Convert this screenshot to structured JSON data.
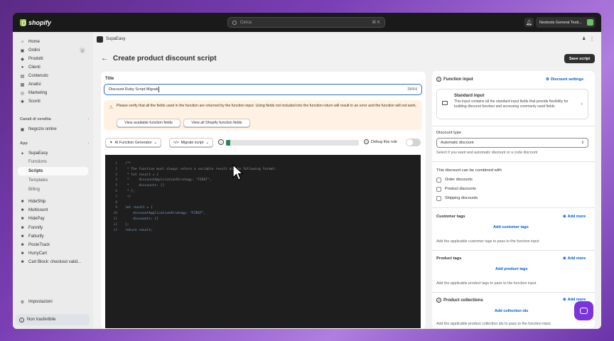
{
  "topbar": {
    "logo_text": "shopify",
    "search_placeholder": "Cerca",
    "search_shortcut": "⌘ K",
    "store_name": "Nextools General Testi..."
  },
  "sidebar": {
    "items": [
      {
        "label": "Home",
        "icon": "home-icon"
      },
      {
        "label": "Ordini",
        "icon": "orders-icon",
        "badge": "2"
      },
      {
        "label": "Prodotti",
        "icon": "tag-icon"
      },
      {
        "label": "Clienti",
        "icon": "person-icon"
      },
      {
        "label": "Contenuto",
        "icon": "content-icon"
      },
      {
        "label": "Analisi",
        "icon": "chart-icon"
      },
      {
        "label": "Marketing",
        "icon": "target-icon"
      },
      {
        "label": "Sconti",
        "icon": "discount-icon"
      }
    ],
    "sales_channels_label": "Canali di vendita",
    "online_store": "Negozio online",
    "apps_label": "App",
    "app_supaeasy": "SupaEasy",
    "subitems": [
      "Functions",
      "Scripts",
      "Templates",
      "Billing"
    ],
    "apps": [
      "HideShip",
      "Multicount",
      "HidePay",
      "Formify",
      "Fatturify",
      "PosteTrack",
      "HurryCart",
      "Cart Block: checkout valid..."
    ],
    "settings": "Impostazioni",
    "transfer": "Non trasferibile"
  },
  "app": {
    "name": "SupaEasy",
    "page_title": "Create product discount script",
    "save_label": "Save script"
  },
  "form": {
    "title_label": "Title",
    "title_value": "Discount Ruby Script Migrati",
    "title_count": "28/64",
    "banner_text": "Please verify that all the fields used in the function are returned by the function input. Using fields not included into the function return will result in an error and the function will not work.",
    "btn_available": "View available function fields",
    "btn_all": "View all Shopify function fields",
    "ai_generator": "AI Function Generator",
    "migrate_script": "Migrate script",
    "progress": 0.03,
    "debug_label": "Debug this rule"
  },
  "code": [
    {
      "n": "1",
      "t": "/**"
    },
    {
      "n": "2",
      "t": " * The function must always return a variable result at the following format:"
    },
    {
      "n": "3",
      "t": " * let result = {"
    },
    {
      "n": "4",
      "t": " *     discountApplicationStrategy: \"FIRST\","
    },
    {
      "n": "5",
      "t": " *     discounts: []"
    },
    {
      "n": "6",
      "t": " * };"
    },
    {
      "n": "7",
      "t": " */"
    },
    {
      "n": "8",
      "t": ""
    },
    {
      "n": "9",
      "t": "let result = {"
    },
    {
      "n": "10",
      "t": "    discountApplicationStrategy: \"FIRST\","
    },
    {
      "n": "11",
      "t": "    discounts: []"
    },
    {
      "n": "12",
      "t": "};"
    },
    {
      "n": "13",
      "t": "return result;"
    }
  ],
  "right": {
    "function_input": "Function input",
    "discount_settings": "Discount settings",
    "standard_title": "Standard input",
    "standard_desc": "This input contains all the standard input fields that provide flexibility for building discount function and accessing commonly used fields",
    "discount_type_label": "Discount type",
    "discount_type_value": "Automatic discount",
    "discount_type_help": "Select if you want and automatic discount or a code discount",
    "combine_label": "This discount can be combined with",
    "combine_options": [
      "Order discounts",
      "Product discounts",
      "Shipping discounts"
    ],
    "customer_tags": "Customer tags",
    "add_more": "Add more",
    "add_customer_tags": "Add customer tags",
    "customer_tags_help": "Add the applicable customer tags to pass to the function input",
    "product_tags": "Product tags",
    "add_product_tags": "Add product tags",
    "product_tags_help": "Add the applicable product tags to pass to the function input",
    "product_collections": "Product collections",
    "add_collection_ids": "Add collection ids",
    "collections_help": "Add the applicable product collection ids to pass to the function input"
  }
}
